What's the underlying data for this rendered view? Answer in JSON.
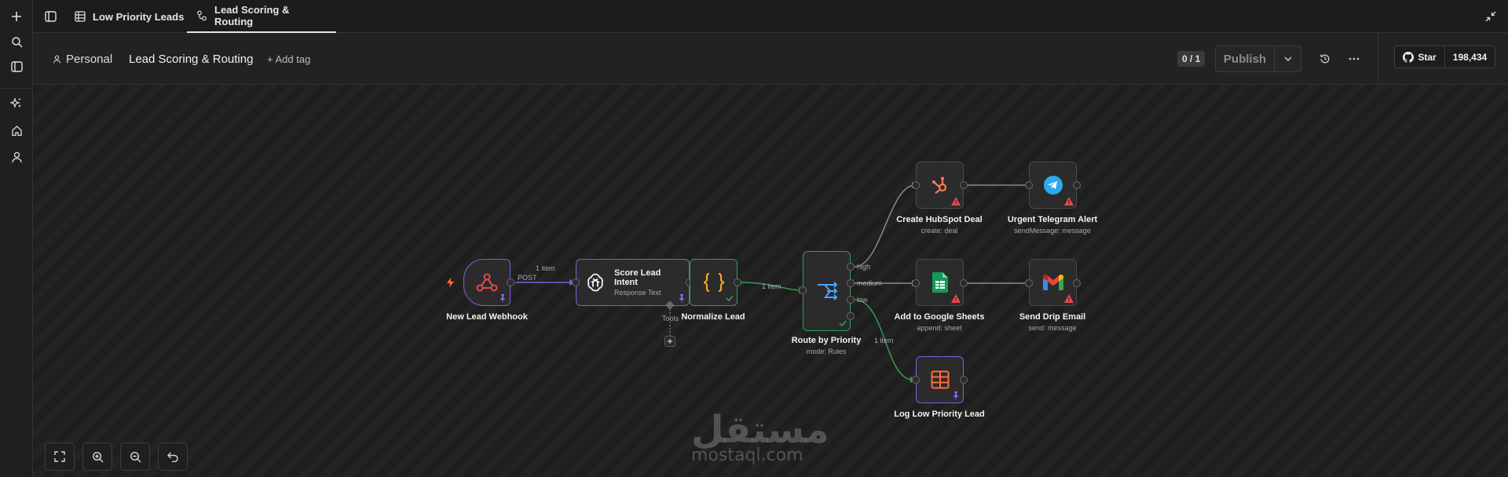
{
  "tabs": [
    {
      "label": "Low Priority Leads",
      "icon": "table-icon"
    },
    {
      "label": "Lead Scoring & Routing",
      "icon": "workflow-icon",
      "active": true
    }
  ],
  "header": {
    "project": "Personal",
    "title": "Lead Scoring & Routing",
    "add_tag": "+ Add tag",
    "version": "0 / 1",
    "publish_label": "Publish",
    "github_star_label": "Star",
    "github_star_count": "198,434"
  },
  "nodes": {
    "webhook": {
      "label": "New Lead Webhook"
    },
    "score": {
      "title": "Score Lead Intent",
      "subtitle": "Response Text"
    },
    "normalize": {
      "label": "Normalize Lead"
    },
    "route": {
      "label": "Route by Priority",
      "subtitle": "mode: Rules"
    },
    "hubspot": {
      "label": "Create HubSpot Deal",
      "subtitle": "create: deal"
    },
    "telegram": {
      "label": "Urgent Telegram Alert",
      "subtitle": "sendMessage: message"
    },
    "sheets": {
      "label": "Add to Google Sheets",
      "subtitle": "append: sheet"
    },
    "email": {
      "label": "Send Drip Email",
      "subtitle": "send: message"
    },
    "log": {
      "label": "Log Low Priority Lead"
    }
  },
  "edge_labels": {
    "post": "POST",
    "item1": "1 item",
    "item2": "1 item",
    "item3": "1 item",
    "tools": "Tools",
    "high": "high",
    "medium": "medium",
    "low": "low"
  },
  "watermark": {
    "arabic": "مستقل",
    "latin": "mostaql.com"
  },
  "colors": {
    "accent_purple": "#7b61d9",
    "success_green": "#2f9e56",
    "warning_red": "#e5484d"
  }
}
